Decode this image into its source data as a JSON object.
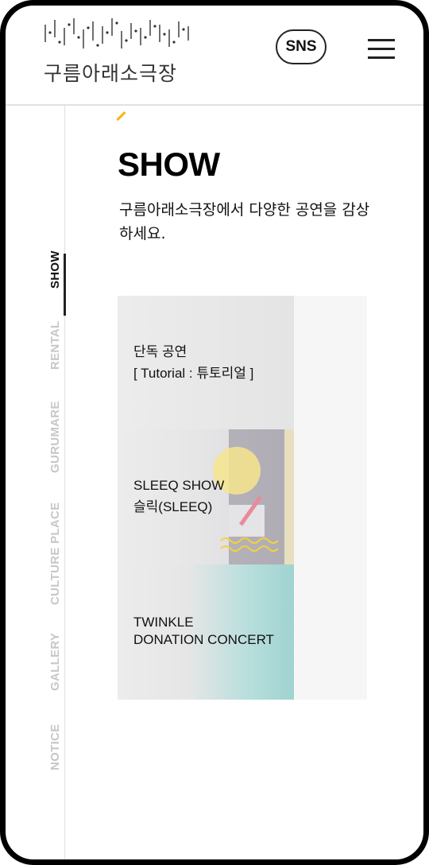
{
  "header": {
    "logo_text": "구름아래소극장",
    "sns_label": "SNS"
  },
  "side_nav": {
    "items": [
      {
        "label": "SHOW",
        "active": true
      },
      {
        "label": "RENTAL",
        "active": false
      },
      {
        "label": "GURUMARE",
        "active": false
      },
      {
        "label": "CULTURE PLACE",
        "active": false
      },
      {
        "label": "GALLERY",
        "active": false
      },
      {
        "label": "NOTICE",
        "active": false
      }
    ]
  },
  "main": {
    "title": "SHOW",
    "description": "구름아래소극장에서 다양한 공연을 감상하세요.",
    "cards": [
      {
        "line1": "단독 공연",
        "line2": "[ Tutorial : 튜토리얼 ]"
      },
      {
        "line1": "SLEEQ SHOW",
        "line2": "슬릭(SLEEQ)"
      },
      {
        "line1": "TWINKLE",
        "line2": "DONATION CONCERT"
      }
    ]
  },
  "colors": {
    "accent": "#f2b705",
    "active_nav": "#111111",
    "inactive_nav": "#c7c7c7",
    "teal": "#9fd3d0"
  },
  "icons": {
    "menu": "hamburger-icon",
    "logo": "logo-mark-icon"
  }
}
